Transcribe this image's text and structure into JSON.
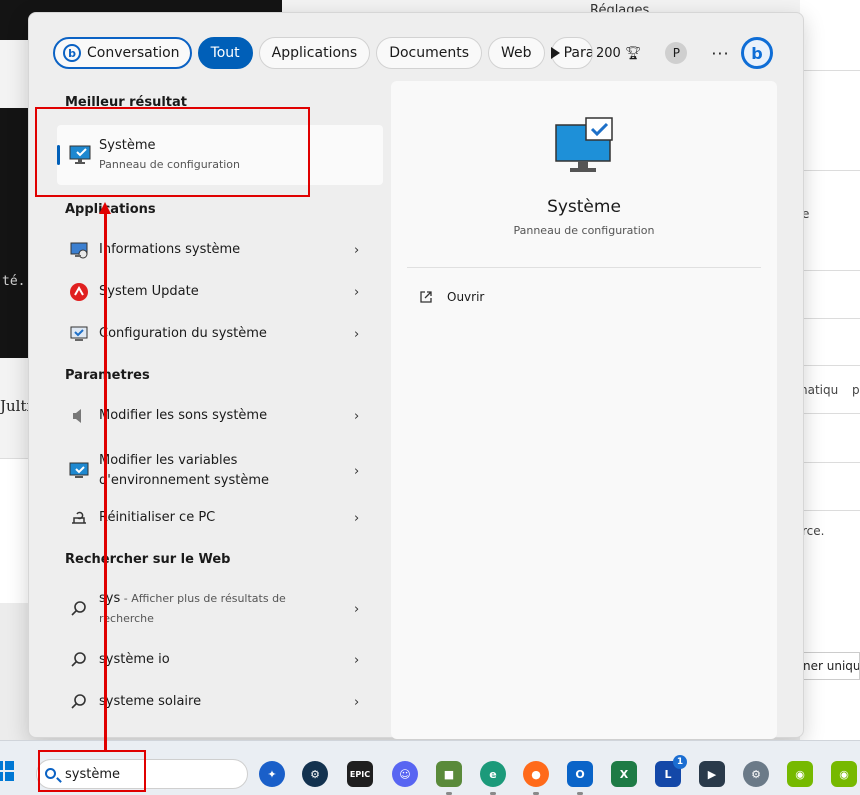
{
  "background": {
    "terminal_fragment": "té.",
    "doc_fragment": "Jultil",
    "top_right_label": "Réglages",
    "right_fragments": [
      "e",
      "natiqu",
      "p",
      "rce.",
      "ner unique"
    ]
  },
  "tabs": {
    "conversation": "Conversation",
    "all": "Tout",
    "applications": "Applications",
    "documents": "Documents",
    "web": "Web",
    "settings": "Para",
    "points": "200",
    "avatar_letter": "P",
    "more": "···",
    "bing_letter": "b"
  },
  "best_match": {
    "heading": "Meilleur résultat",
    "title": "Système",
    "subtitle": "Panneau de configuration"
  },
  "applications": {
    "heading": "Applications",
    "items": [
      {
        "label": "Informations système"
      },
      {
        "label": "System Update"
      },
      {
        "label": "Configuration du système"
      }
    ]
  },
  "settings": {
    "heading": "Parametres",
    "items": [
      {
        "label": "Modifier les sons système"
      },
      {
        "label": "Modifier les variables d'environnement système"
      },
      {
        "label": "Réinitialiser ce PC"
      }
    ]
  },
  "web": {
    "heading": "Rechercher sur le Web",
    "items": [
      {
        "label": "sys",
        "sub": " - Afficher plus de résultats de recherche"
      },
      {
        "label": "système io"
      },
      {
        "label": "systeme solaire"
      }
    ]
  },
  "preview": {
    "title": "Système",
    "subtitle": "Panneau de configuration",
    "open_label": "Ouvrir"
  },
  "taskbar": {
    "search_value": "système",
    "apps": [
      "copilot",
      "steam",
      "epic",
      "discord",
      "minecraft",
      "edge",
      "firefox",
      "outlook",
      "excel",
      "lexique",
      "kdenlive",
      "settings",
      "nvidia",
      "nvidia-2"
    ],
    "epic_label": "EPIC",
    "excel_label": "X",
    "lexique_label": "L",
    "lexique_badge": "1"
  },
  "colors": {
    "accent": "#005fb8",
    "annotation_red": "#e00000"
  }
}
